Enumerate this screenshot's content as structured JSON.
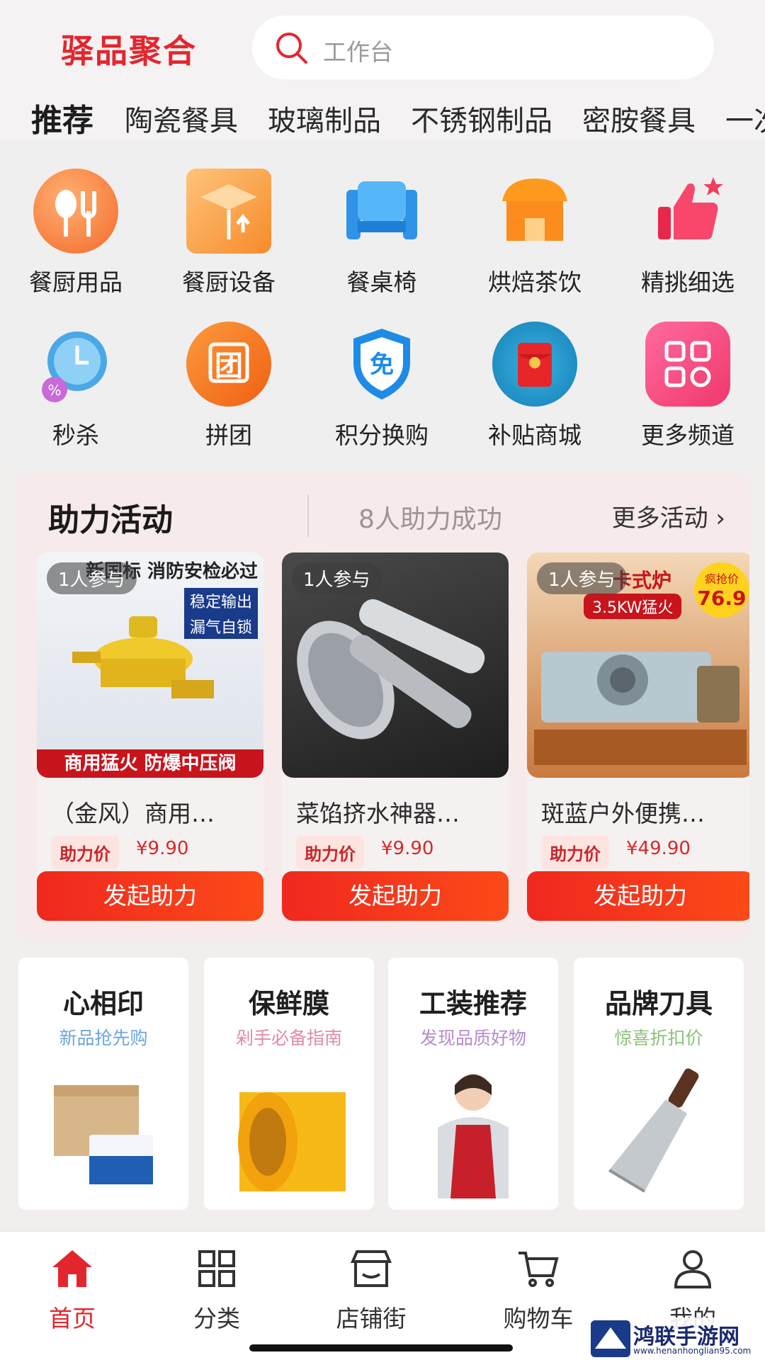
{
  "app": {
    "logo": "驿品聚合"
  },
  "search": {
    "placeholder": "工作台"
  },
  "tabs": [
    "推荐",
    "陶瓷餐具",
    "玻璃制品",
    "不锈钢制品",
    "密胺餐具",
    "一次"
  ],
  "grid": [
    {
      "label": "餐厨用品",
      "icon": "tableware-icon",
      "color": "#f97f3d"
    },
    {
      "label": "餐厨设备",
      "icon": "box-icon",
      "color": "#f9a24a"
    },
    {
      "label": "餐桌椅",
      "icon": "chair-icon",
      "color": "#3aa0f0"
    },
    {
      "label": "烘焙茶饮",
      "icon": "shop-icon",
      "color": "#fb8c1d"
    },
    {
      "label": "精挑细选",
      "icon": "thumbs-up-icon",
      "color": "#f53d5e"
    },
    {
      "label": "秒杀",
      "icon": "alarm-clock-icon",
      "color": "#4aa8e6"
    },
    {
      "label": "拼团",
      "icon": "group-icon",
      "color": "#f77419",
      "glyph": "团"
    },
    {
      "label": "积分换购",
      "icon": "shield-icon",
      "color": "#1e8be6",
      "glyph": "免"
    },
    {
      "label": "补贴商城",
      "icon": "red-envelope-icon",
      "color": "#1fa0d0"
    },
    {
      "label": "更多频道",
      "icon": "more-channels-icon",
      "color": "#f24a78"
    }
  ],
  "assist": {
    "title": "助力活动",
    "count_text": "8人助力成功",
    "more": "更多活动 ›",
    "cards": [
      {
        "badge": "1人参与",
        "name": "（金风）商用…",
        "price_label": "助力价",
        "price": "¥9.90",
        "button": "发起助力",
        "img_text_top": "新国标 消防安检必过",
        "img_text_1": "稳定输出",
        "img_text_2": "漏气自锁",
        "img_text_bottom": "商用猛火 防爆中压阀"
      },
      {
        "badge": "1人参与",
        "name": "菜馅挤水神器…",
        "price_label": "助力价",
        "price": "¥9.90",
        "button": "发起助力"
      },
      {
        "badge": "1人参与",
        "name": "斑蓝户外便携…",
        "price_label": "助力价",
        "price": "¥49.90",
        "button": "发起助力",
        "img_text_top": "卡式炉",
        "img_text_1": "3.5KW猛火",
        "img_price": "76.9",
        "img_price_label": "疯抢价"
      }
    ]
  },
  "promos": [
    {
      "title": "心相印",
      "subtitle": "新品抢先购",
      "sub_color": "#6aa6dd",
      "icon": "tissue-box-icon"
    },
    {
      "title": "保鲜膜",
      "subtitle": "剁手必备指南",
      "sub_color": "#e08aa8",
      "icon": "plastic-wrap-icon"
    },
    {
      "title": "工装推荐",
      "subtitle": "发现品质好物",
      "sub_color": "#b58ad0",
      "icon": "apron-worker-icon"
    },
    {
      "title": "品牌刀具",
      "subtitle": "惊喜折扣价",
      "sub_color": "#8cc07a",
      "icon": "cleaver-knife-icon"
    }
  ],
  "nav": [
    {
      "label": "首页",
      "icon": "home-icon",
      "active": true
    },
    {
      "label": "分类",
      "icon": "category-grid-icon"
    },
    {
      "label": "店铺街",
      "icon": "store-icon"
    },
    {
      "label": "购物车",
      "icon": "cart-icon"
    },
    {
      "label": "我的",
      "icon": "user-icon"
    }
  ],
  "watermark": {
    "name": "鸿联手游网",
    "url": "www.henanhonglian95.com"
  },
  "colors": {
    "brand": "#e3262e",
    "button": "#f0281f"
  }
}
